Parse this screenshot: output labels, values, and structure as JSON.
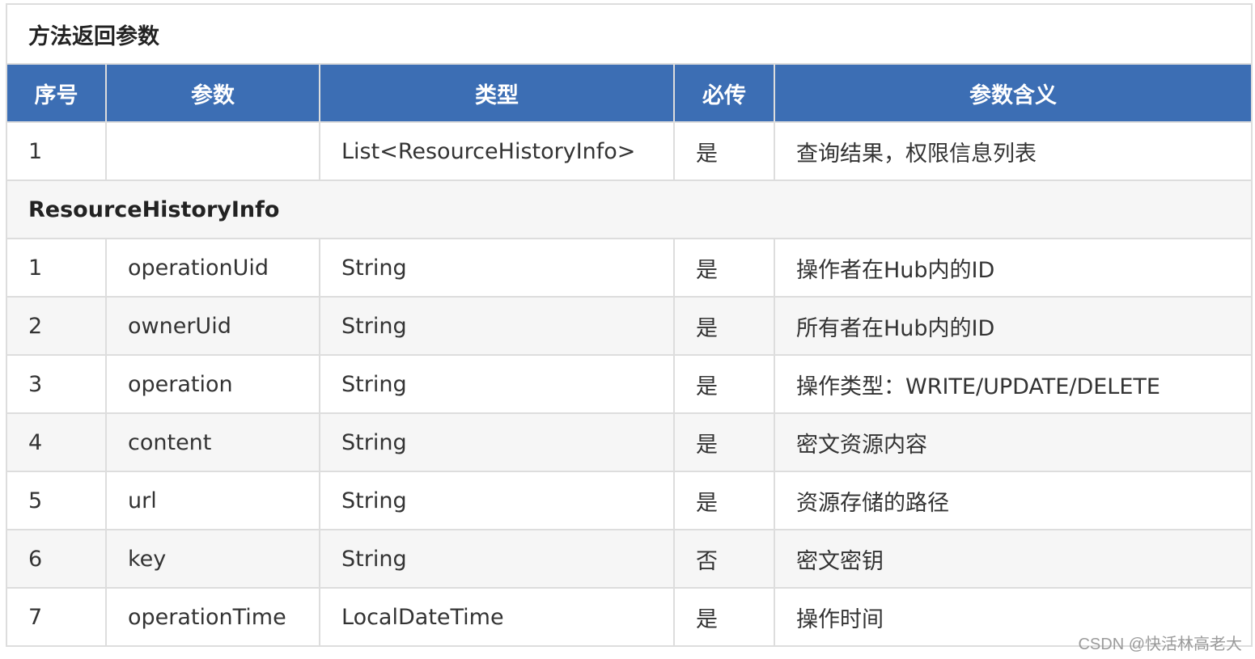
{
  "title": "方法返回参数",
  "headers": [
    "序号",
    "参数",
    "类型",
    "必传",
    "参数含义"
  ],
  "first_row": {
    "no": "1",
    "param": "",
    "type": "List<ResourceHistoryInfo>",
    "required": "是",
    "meaning": "查询结果，权限信息列表"
  },
  "section_label": "ResourceHistoryInfo",
  "rows": [
    {
      "no": "1",
      "param": "operationUid",
      "type": "String",
      "required": "是",
      "meaning": "操作者在Hub内的ID"
    },
    {
      "no": "2",
      "param": "ownerUid",
      "type": "String",
      "required": "是",
      "meaning": "所有者在Hub内的ID"
    },
    {
      "no": "3",
      "param": "operation",
      "type": "String",
      "required": "是",
      "meaning": "操作类型：WRITE/UPDATE/DELETE"
    },
    {
      "no": "4",
      "param": "content",
      "type": "String",
      "required": "是",
      "meaning": "密文资源内容"
    },
    {
      "no": "5",
      "param": "url",
      "type": "String",
      "required": "是",
      "meaning": "资源存储的路径"
    },
    {
      "no": "6",
      "param": "key",
      "type": "String",
      "required": "否",
      "meaning": "密文密钥"
    },
    {
      "no": "7",
      "param": "operationTime",
      "type": "LocalDateTime",
      "required": "是",
      "meaning": "操作时间"
    }
  ],
  "watermark": "CSDN @快活林高老大"
}
